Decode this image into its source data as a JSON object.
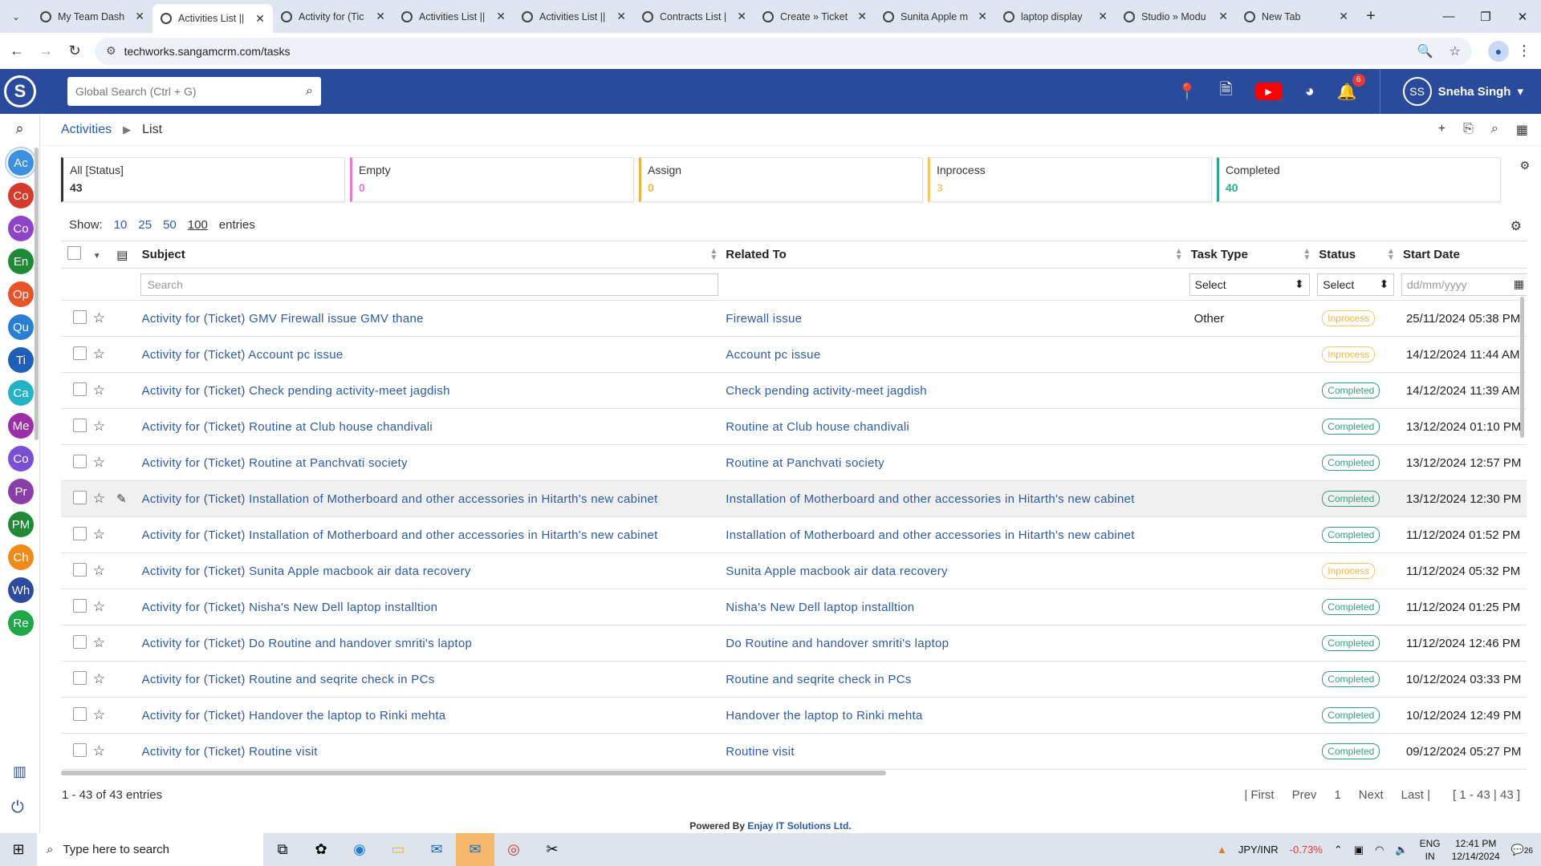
{
  "browser": {
    "tabs": [
      {
        "title": "My Team Dash",
        "active": false
      },
      {
        "title": "Activities List ||",
        "active": true
      },
      {
        "title": "Activity for (Tic",
        "active": false
      },
      {
        "title": "Activities List ||",
        "active": false
      },
      {
        "title": "Activities List ||",
        "active": false
      },
      {
        "title": "Contracts List |",
        "active": false
      },
      {
        "title": "Create » Ticket",
        "active": false
      },
      {
        "title": "Sunita Apple m",
        "active": false
      },
      {
        "title": "laptop display",
        "active": false
      },
      {
        "title": "Studio » Modu",
        "active": false
      },
      {
        "title": "New Tab",
        "active": false
      }
    ],
    "url": "techworks.sangamcrm.com/tasks"
  },
  "header": {
    "search_placeholder": "Global Search (Ctrl + G)",
    "notification_count": "6",
    "user_initials": "SS",
    "user_name": "Sneha Singh"
  },
  "rail": {
    "items": [
      {
        "label": "Ac",
        "color": "#3d8fe0"
      },
      {
        "label": "Co",
        "color": "#d63a2a"
      },
      {
        "label": "Co",
        "color": "#8e44c9"
      },
      {
        "label": "En",
        "color": "#1e8a35"
      },
      {
        "label": "Op",
        "color": "#e8542a"
      },
      {
        "label": "Qu",
        "color": "#2a7fd4"
      },
      {
        "label": "Ti",
        "color": "#1f5fb8"
      },
      {
        "label": "Ca",
        "color": "#23b3c4"
      },
      {
        "label": "Me",
        "color": "#9c2fa8"
      },
      {
        "label": "Co",
        "color": "#7a4fd6"
      },
      {
        "label": "Pr",
        "color": "#8a3fa8"
      },
      {
        "label": "PM",
        "color": "#1e8a35"
      },
      {
        "label": "Ch",
        "color": "#f08a1a"
      },
      {
        "label": "Wh",
        "color": "#2e4a9e"
      },
      {
        "label": "Re",
        "color": "#1fa84a"
      }
    ]
  },
  "breadcrumb": {
    "module": "Activities",
    "page": "List"
  },
  "status_cards": [
    {
      "label": "All [Status]",
      "count": "43",
      "color": "#333333"
    },
    {
      "label": "Empty",
      "count": "0",
      "color": "#e27bd6"
    },
    {
      "label": "Assign",
      "count": "0",
      "color": "#f0b440"
    },
    {
      "label": "Inprocess",
      "count": "3",
      "color": "#f5c76b"
    },
    {
      "label": "Completed",
      "count": "40",
      "color": "#2aa88a"
    }
  ],
  "show": {
    "label": "Show:",
    "options": [
      "10",
      "25",
      "50",
      "100"
    ],
    "current": "100",
    "suffix": "entries"
  },
  "table": {
    "columns": [
      "Subject",
      "Related To",
      "Task Type",
      "Status",
      "Start Date"
    ],
    "filters": {
      "subject_placeholder": "Search",
      "task_type": "Select",
      "status": "Select",
      "date_placeholder": "dd/mm/yyyy"
    },
    "rows": [
      {
        "subject": "Activity for (Ticket) GMV Firewall issue GMV thane",
        "related": "Firewall issue",
        "type": "Other",
        "status": "Inprocess",
        "date": "25/11/2024 05:38 PM"
      },
      {
        "subject": "Activity for (Ticket) Account pc issue",
        "related": "Account pc issue",
        "type": "",
        "status": "Inprocess",
        "date": "14/12/2024 11:44 AM"
      },
      {
        "subject": "Activity for (Ticket) Check pending activity-meet jagdish",
        "related": "Check pending activity-meet jagdish",
        "type": "",
        "status": "Completed",
        "date": "14/12/2024 11:39 AM"
      },
      {
        "subject": "Activity for (Ticket) Routine at Club house chandivali",
        "related": "Routine at Club house chandivali",
        "type": "",
        "status": "Completed",
        "date": "13/12/2024 01:10 PM"
      },
      {
        "subject": "Activity for (Ticket) Routine at Panchvati society",
        "related": "Routine at Panchvati society",
        "type": "",
        "status": "Completed",
        "date": "13/12/2024 12:57 PM"
      },
      {
        "subject": "Activity for (Ticket) Installation of Motherboard and other accessories in Hitarth's new cabinet",
        "related": "Installation of Motherboard and other accessories in Hitarth's new cabinet",
        "type": "",
        "status": "Completed",
        "date": "13/12/2024 12:30 PM"
      },
      {
        "subject": "Activity for (Ticket) Installation of Motherboard and other accessories in Hitarth's new cabinet",
        "related": "Installation of Motherboard and other accessories in Hitarth's new cabinet",
        "type": "",
        "status": "Completed",
        "date": "11/12/2024 01:52 PM"
      },
      {
        "subject": "Activity for (Ticket) Sunita Apple macbook air data recovery",
        "related": "Sunita Apple macbook air data recovery",
        "type": "",
        "status": "Inprocess",
        "date": "11/12/2024 05:32 PM"
      },
      {
        "subject": "Activity for (Ticket) Nisha's New Dell laptop installtion",
        "related": "Nisha's New Dell laptop installtion",
        "type": "",
        "status": "Completed",
        "date": "11/12/2024 01:25 PM"
      },
      {
        "subject": "Activity for (Ticket) Do Routine and handover smriti's laptop",
        "related": "Do Routine and handover smriti's laptop",
        "type": "",
        "status": "Completed",
        "date": "11/12/2024 12:46 PM"
      },
      {
        "subject": "Activity for (Ticket) Routine and seqrite check in PCs",
        "related": "Routine and seqrite check in PCs",
        "type": "",
        "status": "Completed",
        "date": "10/12/2024 03:33 PM"
      },
      {
        "subject": "Activity for (Ticket) Handover the laptop to Rinki mehta",
        "related": "Handover the laptop to Rinki mehta",
        "type": "",
        "status": "Completed",
        "date": "10/12/2024 12:49 PM"
      },
      {
        "subject": "Activity for (Ticket) Routine visit",
        "related": "Routine visit",
        "type": "",
        "status": "Completed",
        "date": "09/12/2024 05:27 PM"
      }
    ]
  },
  "footer": {
    "summary": "1 - 43 of 43 entries",
    "pager": [
      "| First",
      "Prev",
      "1",
      "Next",
      "Last |",
      "[ 1 - 43 | 43 ]"
    ],
    "powered_prefix": "Powered By",
    "powered_company": "Enjay IT Solutions Ltd."
  },
  "taskbar": {
    "search_placeholder": "Type here to search",
    "ticker_label": "JPY/INR",
    "ticker_value": "-0.73%",
    "lang1": "ENG",
    "lang2": "IN",
    "time": "12:41 PM",
    "date": "12/14/2024",
    "notif": "26"
  }
}
